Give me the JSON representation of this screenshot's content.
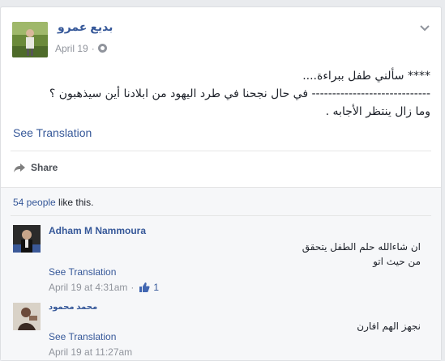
{
  "post": {
    "author": "بديع عمرو",
    "date": "April 19",
    "separator": "·",
    "text_lines": [
      "**** سألني طفل ببراءة....",
      "----------------------------- في حال نجحنا في طرد اليهود من ابلادنا أين سيذهبون ؟",
      "وما زال ينتظر الأجابه ."
    ],
    "see_translation": "See Translation",
    "share_label": "Share",
    "icons": {
      "privacy": "globe-icon",
      "menu": "chevron-down-icon",
      "share": "share-icon"
    }
  },
  "likes": {
    "count_text": "54 people",
    "suffix": " like this."
  },
  "comments": [
    {
      "author": "Adham M Nammoura",
      "text_lines": [
        "ان شاءالله حلم الطفل يتحقق",
        "من حيث اتو"
      ],
      "see_translation": "See Translation",
      "time": "April 19 at 4:31am",
      "meta_separator": "·",
      "likes": "1"
    },
    {
      "author": "محمد محمود",
      "text_lines": [
        "نجهز الهم افارن"
      ],
      "see_translation": "See Translation",
      "time": "April 19 at 11:27am"
    }
  ],
  "colors": {
    "link": "#365899",
    "muted": "#90949c",
    "text": "#1d2129",
    "like_blue": "#4267b2"
  }
}
